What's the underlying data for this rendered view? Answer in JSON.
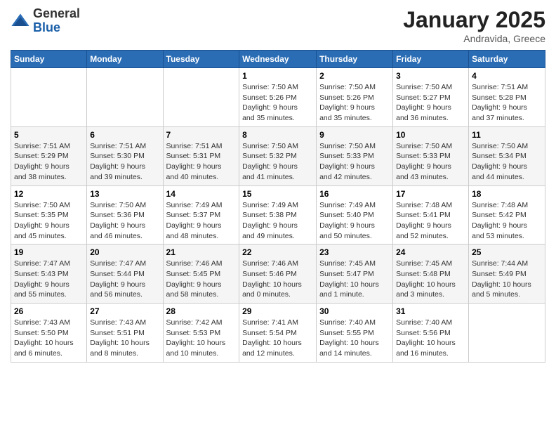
{
  "logo": {
    "general": "General",
    "blue": "Blue"
  },
  "header": {
    "month": "January 2025",
    "location": "Andravida, Greece"
  },
  "days_of_week": [
    "Sunday",
    "Monday",
    "Tuesday",
    "Wednesday",
    "Thursday",
    "Friday",
    "Saturday"
  ],
  "weeks": [
    [
      {
        "day": "",
        "info": ""
      },
      {
        "day": "",
        "info": ""
      },
      {
        "day": "",
        "info": ""
      },
      {
        "day": "1",
        "info": "Sunrise: 7:50 AM\nSunset: 5:26 PM\nDaylight: 9 hours\nand 35 minutes."
      },
      {
        "day": "2",
        "info": "Sunrise: 7:50 AM\nSunset: 5:26 PM\nDaylight: 9 hours\nand 35 minutes."
      },
      {
        "day": "3",
        "info": "Sunrise: 7:50 AM\nSunset: 5:27 PM\nDaylight: 9 hours\nand 36 minutes."
      },
      {
        "day": "4",
        "info": "Sunrise: 7:51 AM\nSunset: 5:28 PM\nDaylight: 9 hours\nand 37 minutes."
      }
    ],
    [
      {
        "day": "5",
        "info": "Sunrise: 7:51 AM\nSunset: 5:29 PM\nDaylight: 9 hours\nand 38 minutes."
      },
      {
        "day": "6",
        "info": "Sunrise: 7:51 AM\nSunset: 5:30 PM\nDaylight: 9 hours\nand 39 minutes."
      },
      {
        "day": "7",
        "info": "Sunrise: 7:51 AM\nSunset: 5:31 PM\nDaylight: 9 hours\nand 40 minutes."
      },
      {
        "day": "8",
        "info": "Sunrise: 7:50 AM\nSunset: 5:32 PM\nDaylight: 9 hours\nand 41 minutes."
      },
      {
        "day": "9",
        "info": "Sunrise: 7:50 AM\nSunset: 5:33 PM\nDaylight: 9 hours\nand 42 minutes."
      },
      {
        "day": "10",
        "info": "Sunrise: 7:50 AM\nSunset: 5:33 PM\nDaylight: 9 hours\nand 43 minutes."
      },
      {
        "day": "11",
        "info": "Sunrise: 7:50 AM\nSunset: 5:34 PM\nDaylight: 9 hours\nand 44 minutes."
      }
    ],
    [
      {
        "day": "12",
        "info": "Sunrise: 7:50 AM\nSunset: 5:35 PM\nDaylight: 9 hours\nand 45 minutes."
      },
      {
        "day": "13",
        "info": "Sunrise: 7:50 AM\nSunset: 5:36 PM\nDaylight: 9 hours\nand 46 minutes."
      },
      {
        "day": "14",
        "info": "Sunrise: 7:49 AM\nSunset: 5:37 PM\nDaylight: 9 hours\nand 48 minutes."
      },
      {
        "day": "15",
        "info": "Sunrise: 7:49 AM\nSunset: 5:38 PM\nDaylight: 9 hours\nand 49 minutes."
      },
      {
        "day": "16",
        "info": "Sunrise: 7:49 AM\nSunset: 5:40 PM\nDaylight: 9 hours\nand 50 minutes."
      },
      {
        "day": "17",
        "info": "Sunrise: 7:48 AM\nSunset: 5:41 PM\nDaylight: 9 hours\nand 52 minutes."
      },
      {
        "day": "18",
        "info": "Sunrise: 7:48 AM\nSunset: 5:42 PM\nDaylight: 9 hours\nand 53 minutes."
      }
    ],
    [
      {
        "day": "19",
        "info": "Sunrise: 7:47 AM\nSunset: 5:43 PM\nDaylight: 9 hours\nand 55 minutes."
      },
      {
        "day": "20",
        "info": "Sunrise: 7:47 AM\nSunset: 5:44 PM\nDaylight: 9 hours\nand 56 minutes."
      },
      {
        "day": "21",
        "info": "Sunrise: 7:46 AM\nSunset: 5:45 PM\nDaylight: 9 hours\nand 58 minutes."
      },
      {
        "day": "22",
        "info": "Sunrise: 7:46 AM\nSunset: 5:46 PM\nDaylight: 10 hours\nand 0 minutes."
      },
      {
        "day": "23",
        "info": "Sunrise: 7:45 AM\nSunset: 5:47 PM\nDaylight: 10 hours\nand 1 minute."
      },
      {
        "day": "24",
        "info": "Sunrise: 7:45 AM\nSunset: 5:48 PM\nDaylight: 10 hours\nand 3 minutes."
      },
      {
        "day": "25",
        "info": "Sunrise: 7:44 AM\nSunset: 5:49 PM\nDaylight: 10 hours\nand 5 minutes."
      }
    ],
    [
      {
        "day": "26",
        "info": "Sunrise: 7:43 AM\nSunset: 5:50 PM\nDaylight: 10 hours\nand 6 minutes."
      },
      {
        "day": "27",
        "info": "Sunrise: 7:43 AM\nSunset: 5:51 PM\nDaylight: 10 hours\nand 8 minutes."
      },
      {
        "day": "28",
        "info": "Sunrise: 7:42 AM\nSunset: 5:53 PM\nDaylight: 10 hours\nand 10 minutes."
      },
      {
        "day": "29",
        "info": "Sunrise: 7:41 AM\nSunset: 5:54 PM\nDaylight: 10 hours\nand 12 minutes."
      },
      {
        "day": "30",
        "info": "Sunrise: 7:40 AM\nSunset: 5:55 PM\nDaylight: 10 hours\nand 14 minutes."
      },
      {
        "day": "31",
        "info": "Sunrise: 7:40 AM\nSunset: 5:56 PM\nDaylight: 10 hours\nand 16 minutes."
      },
      {
        "day": "",
        "info": ""
      }
    ]
  ]
}
